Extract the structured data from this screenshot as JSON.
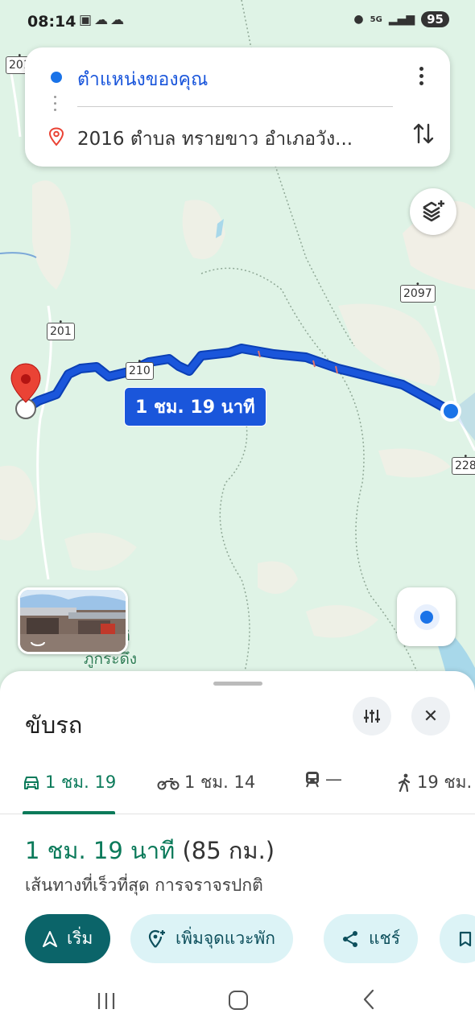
{
  "status_bar": {
    "time": "08:14",
    "left_icons": [
      "screenshot-icon",
      "cloud-icon",
      "weather-icon"
    ],
    "network": "5G",
    "battery": "95"
  },
  "directions": {
    "origin": "ตำแหน่งของคุณ",
    "destination": "2016 ตำบล ทรายขาว อำเภอวัง..."
  },
  "map": {
    "road_labels": [
      "201",
      "2097",
      "201",
      "210",
      "228"
    ],
    "route_time_label": "1 ชม. 19 นาที",
    "place_label": "ห่งชาติ\nภูกระดึง",
    "colors": {
      "route": "#1a56db",
      "land": "#dff3e6",
      "water": "#a8d8ea"
    }
  },
  "sheet": {
    "mode_title": "ขับรถ",
    "tabs": [
      {
        "icon": "car-icon",
        "label": "1 ชม. 19"
      },
      {
        "icon": "motorcycle-icon",
        "label": "1 ชม. 14"
      },
      {
        "icon": "train-icon",
        "label": "—"
      },
      {
        "icon": "walk-icon",
        "label": "19 ชม."
      }
    ],
    "route_duration": "1 ชม. 19 นาที",
    "route_distance": "(85 กม.)",
    "route_description": "เส้นทางที่เร็วที่สุด การจราจรปกติ",
    "actions": {
      "start": "เริ่ม",
      "add_stop": "เพิ่มจุดแวะพัก",
      "share": "แชร์"
    }
  },
  "accent_color": "#0b7a5a"
}
